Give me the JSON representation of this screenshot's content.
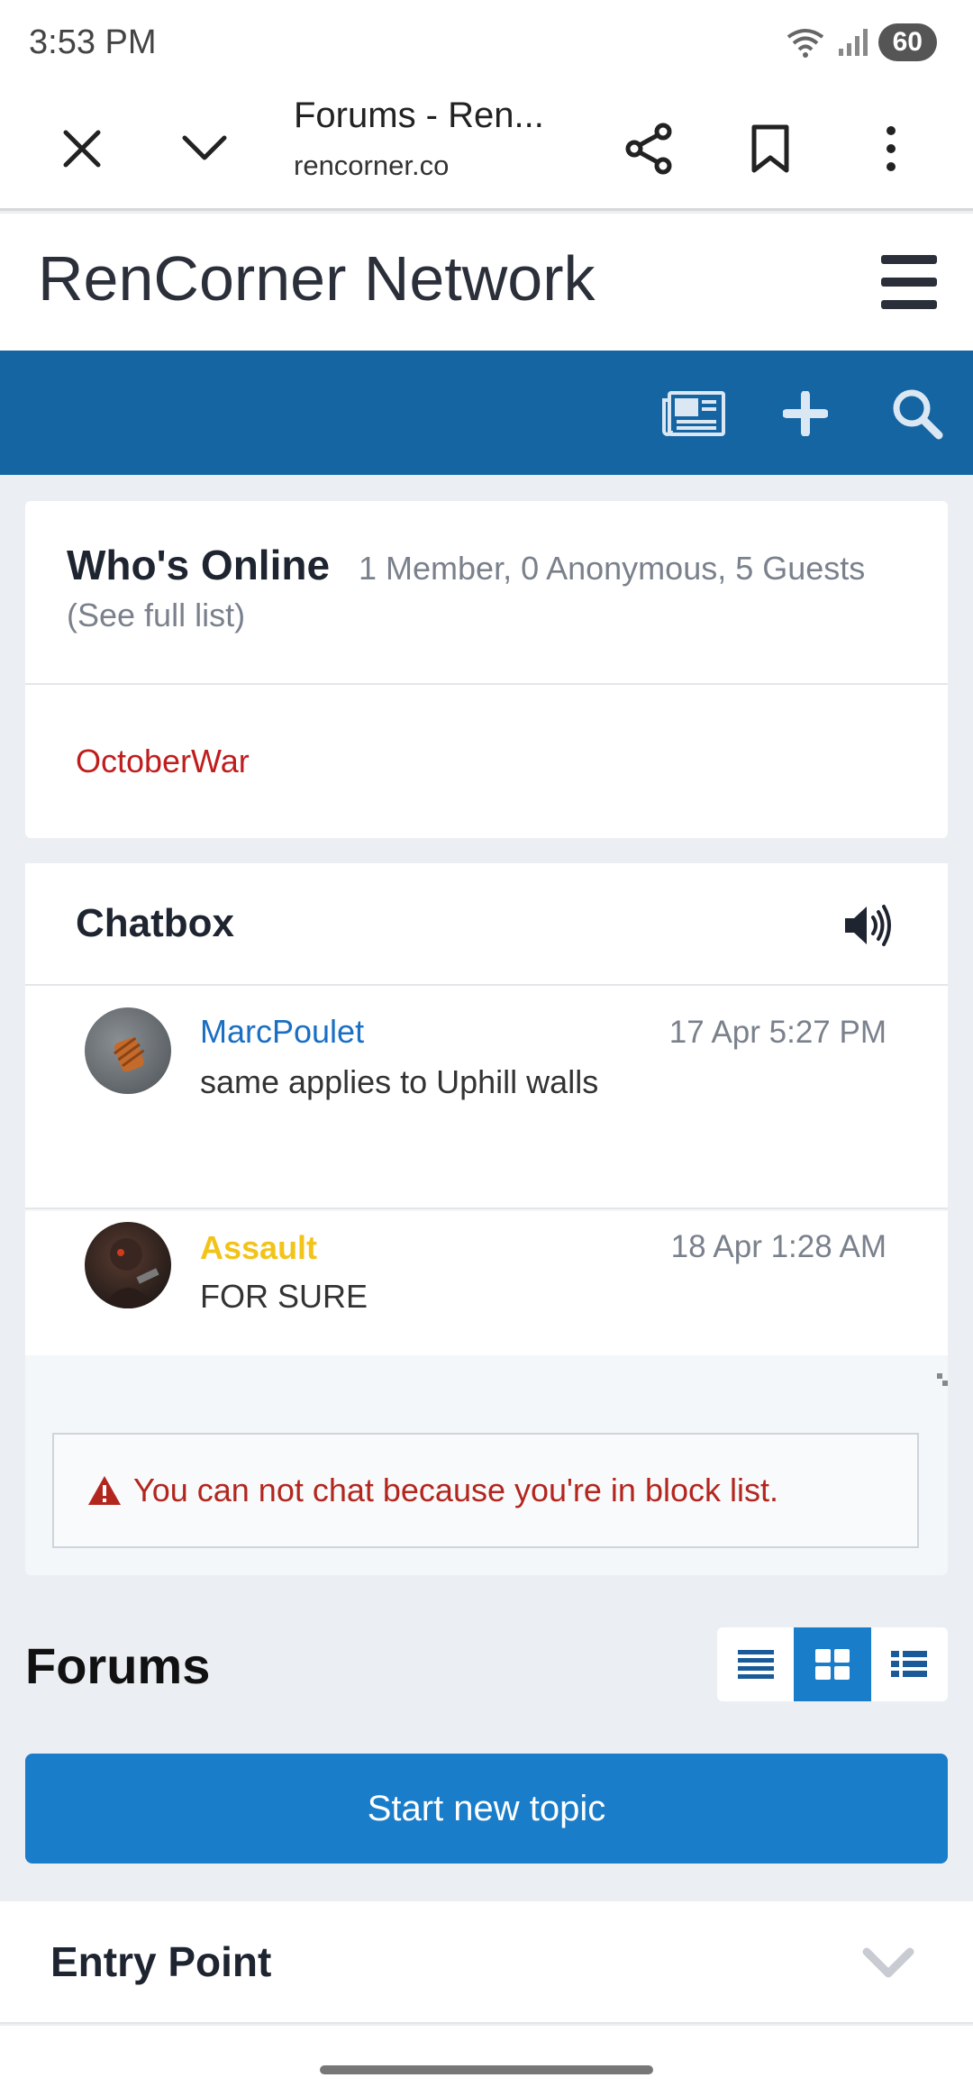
{
  "status_bar": {
    "time": "3:53 PM",
    "battery": "60"
  },
  "browser": {
    "title": "Forums - Ren...",
    "url": "rencorner.co"
  },
  "site": {
    "title": "RenCorner Network"
  },
  "whos_online": {
    "title": "Who's Online",
    "counts": "1 Member, 0 Anonymous, 5 Guests",
    "link": "(See full list)",
    "members": [
      "OctoberWar"
    ]
  },
  "chatbox": {
    "title": "Chatbox",
    "messages": [
      {
        "user": "MarcPoulet",
        "time": "17 Apr 5:27 PM",
        "text": "same applies to Uphill walls",
        "name_color": "#1a6fc4"
      },
      {
        "user": "Assault",
        "time": "18 Apr 1:28 AM",
        "text": "FOR SURE",
        "name_color": "#f2c318"
      }
    ],
    "notice": "You can not chat because you're in block list."
  },
  "forums": {
    "title": "Forums",
    "start_button": "Start new topic",
    "categories": [
      "Entry Point"
    ]
  },
  "colors": {
    "nav_blue": "#1565a3",
    "button_blue": "#1a7dc9",
    "member_red": "#c01d1d"
  }
}
